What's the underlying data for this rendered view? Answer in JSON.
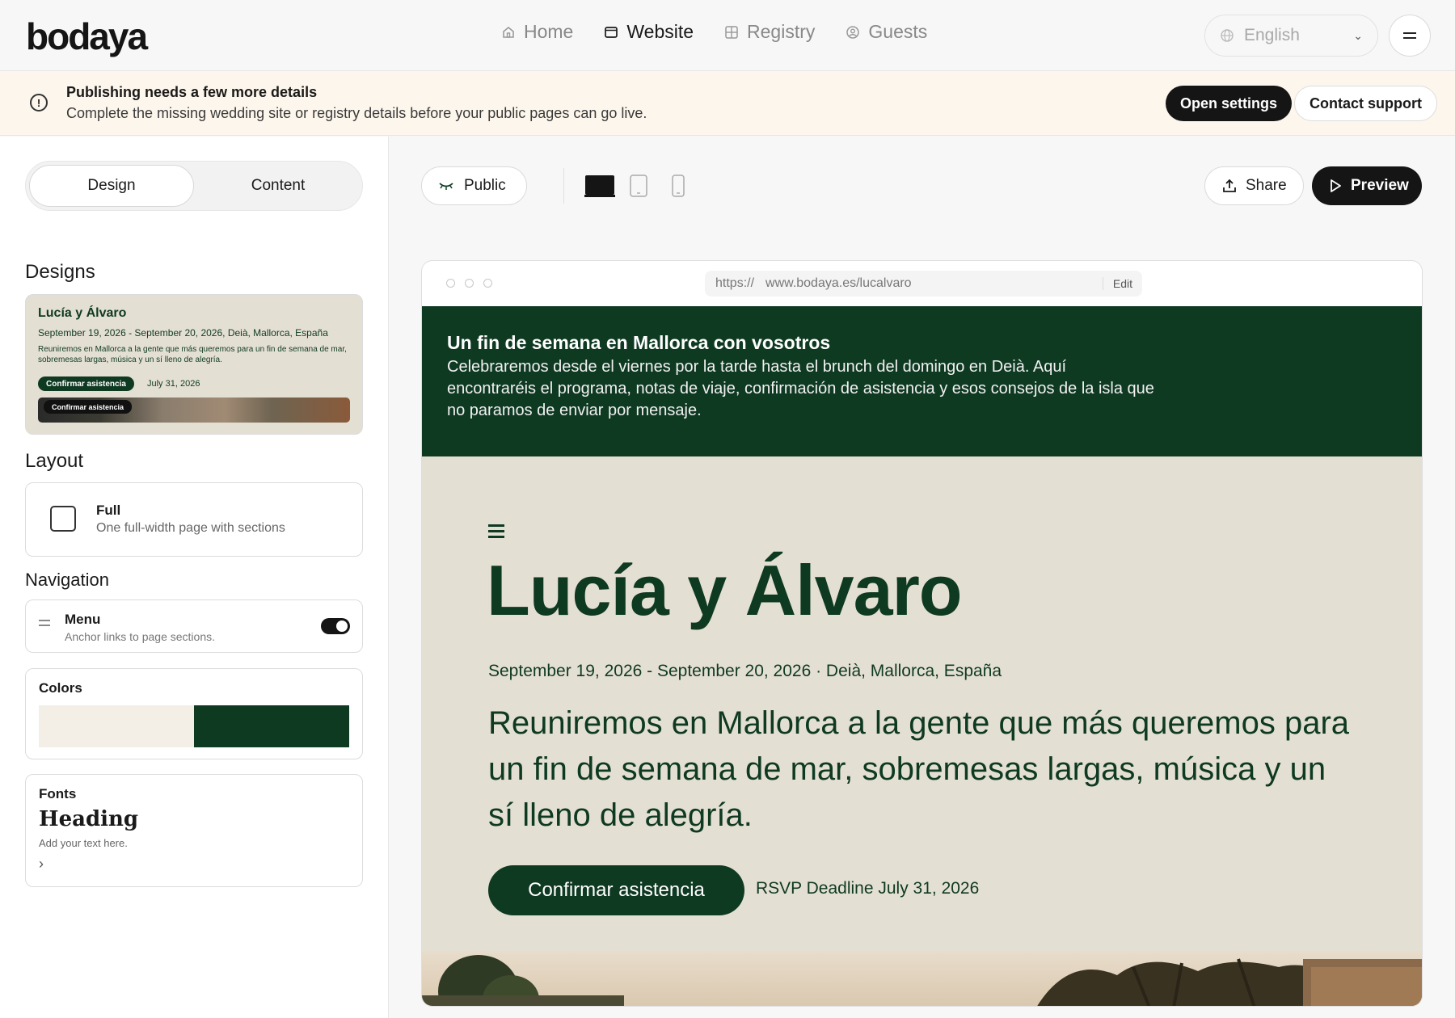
{
  "app": {
    "logo": "bodaya"
  },
  "nav": {
    "items": [
      {
        "label": "Home",
        "icon": "home-icon"
      },
      {
        "label": "Website",
        "icon": "browser-icon",
        "active": true
      },
      {
        "label": "Registry",
        "icon": "grid-icon"
      },
      {
        "label": "Guests",
        "icon": "user-circle-icon"
      }
    ],
    "language": "English"
  },
  "banner": {
    "title": "Publishing needs a few more details",
    "body": "Complete the missing wedding site or registry details before your public pages can go live.",
    "primary": "Open settings",
    "secondary": "Contact support"
  },
  "sidebar": {
    "tabs": [
      "Design",
      "Content"
    ],
    "designs_title": "Designs",
    "design_card": {
      "name": "Lucía y Álvaro",
      "date": "September 19, 2026 - September 20, 2026, Deià, Mallorca, España",
      "desc": "Reuniremos en Mallorca a la gente que más queremos para un fin de semana de mar, sobremesas largas, música y un sí lleno de alegría.",
      "button": "Confirmar asistencia",
      "deadline": "July 31, 2026",
      "image_button": "Confirmar asistencia"
    },
    "layout_title": "Layout",
    "layout": {
      "name": "Full",
      "desc": "One full-width page with sections"
    },
    "navigation_title": "Navigation",
    "navigation": {
      "name": "Menu",
      "desc": "Anchor links to page sections.",
      "enabled": true
    },
    "colors": {
      "title": "Colors",
      "swatches": [
        "#f3efe6",
        "#0f3a22"
      ]
    },
    "fonts": {
      "title": "Fonts",
      "heading": "Heading",
      "sample": "Add your text here."
    }
  },
  "toolbar": {
    "visibility": "Public",
    "devices": [
      "desktop",
      "tablet",
      "mobile"
    ],
    "share": "Share",
    "preview": "Preview"
  },
  "browser": {
    "protocol": "https://",
    "url": "www.bodaya.es/lucalvaro",
    "edit": "Edit"
  },
  "site": {
    "intro_title": "Un fin de semana en Mallorca con vosotros",
    "intro_body": "Celebraremos desde el viernes por la tarde hasta el brunch del domingo en Deià. Aquí encontraréis el programa, notas de viaje, confirmación de asistencia y esos consejos de la isla que no paramos de enviar por mensaje.",
    "name": "Lucía y Álvaro",
    "date": "September 19, 2026 - September 20, 2026 · Deià, Mallorca, España",
    "desc": "Reuniremos en Mallorca a la gente que más queremos para un fin de semana de mar, sobremesas largas, música y un sí lleno de alegría.",
    "rsvp_button": "Confirmar asistencia",
    "rsvp_deadline": "RSVP Deadline July 31, 2026"
  }
}
